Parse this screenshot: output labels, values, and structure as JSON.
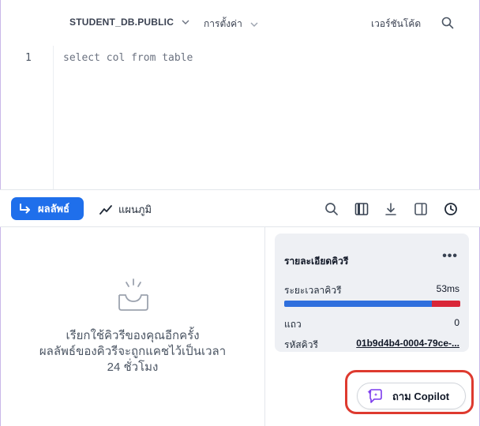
{
  "toolbar": {
    "database": "STUDENT_DB.PUBLIC",
    "settings": "การตั้งค่า",
    "version": "เวอร์ชันโค้ด"
  },
  "editor": {
    "line_number": "1",
    "code": "select col from table"
  },
  "results_bar": {
    "results_label": "ผลลัพธ์",
    "chart_label": "แผนภูมิ",
    "icons": [
      "search-icon",
      "columns-icon",
      "download-icon",
      "split-pane-icon",
      "history-clock-icon"
    ]
  },
  "empty_state": {
    "line1": "เรียกใช้คิวรีของคุณอีกครั้ง",
    "line2": "ผลลัพธ์ของคิวรีจะถูกแคชไว้เป็นเวลา",
    "line3": "24 ชั่วโมง"
  },
  "query_details": {
    "title": "รายละเอียดคิวรี",
    "more": "•••",
    "duration_label": "ระยะเวลาคิวรี",
    "duration_value": "53ms",
    "duration_fraction_blue": 0.84,
    "rows_label": "แถว",
    "rows_value": "0",
    "query_id_label": "รหัสคิวรี",
    "query_id_value": "01b9d4b4-0004-79ce-..."
  },
  "copilot": {
    "label": "ถาม Copilot"
  },
  "colors": {
    "accent": "#1f6feb",
    "highlight_ring": "#de3a2f",
    "bar_blue": "#2f6fdd",
    "bar_red": "#d92638"
  }
}
